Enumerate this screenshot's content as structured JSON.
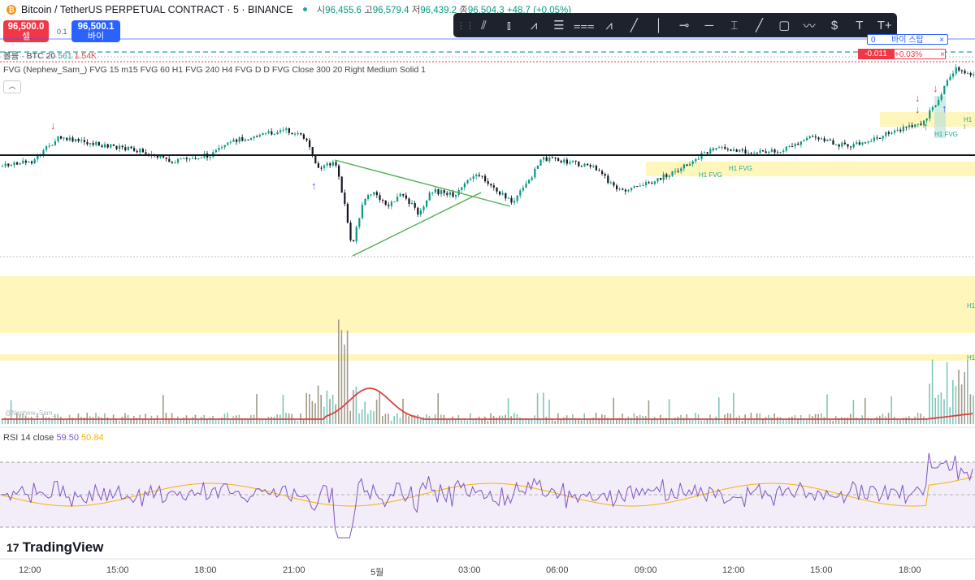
{
  "header": {
    "coin_symbol": "₿",
    "symbol_title": "Bitcoin / TetherUS PERPETUAL CONTRACT · 5 · BINANCE",
    "ohlc": {
      "o_label": "시",
      "o": "96,455.6",
      "h_label": "고",
      "h": "96,579.4",
      "l_label": "저",
      "l": "96,439.2",
      "c_label": "종",
      "c": "96,504.3",
      "change": "+48.7 (+0.05%)"
    }
  },
  "trade": {
    "sell_price": "96,500.0",
    "sell_label": "셀",
    "buy_price": "96,500.1",
    "buy_label": "바이",
    "spread": "0.1"
  },
  "toolbar": {
    "icons": [
      "grip-icon",
      "parallel-channel-icon",
      "regression-trend-icon",
      "xabcd-pattern-icon",
      "fib-retracement-icon",
      "fib-channel-icon",
      "abcd-pattern-icon",
      "trend-line-icon",
      "vertical-line-icon",
      "horizontal-ray-icon",
      "horizontal-line-icon",
      "text-anchor-icon",
      "ray-icon",
      "rectangle-icon",
      "path-icon",
      "price-label-icon",
      "text-icon",
      "text-plus-icon"
    ],
    "glyphs": [
      "⋮⋮",
      "⫽",
      "⫾",
      "⩘",
      "☰",
      "⩶",
      "⩘",
      "╱",
      "│",
      "⊸",
      "─",
      "⌶",
      "╱",
      "▢",
      "〰",
      "$",
      "T",
      "T+"
    ]
  },
  "indicators": {
    "volume": {
      "label": "볼륨 · BTC 20",
      "v1": "561",
      "v2": "1.54K"
    },
    "fvg": "FVG (Nephew_Sam_) FVG 15 m15 FVG 60 H1 FVG 240 H4 FVG D D FVG Close 300 20 Right Medium Solid 1",
    "rsi": {
      "label": "RSI 14 close",
      "value": "59.50",
      "ma": "50.84"
    }
  },
  "orders": {
    "stop_qty": "0",
    "stop_label": "바이 스탑",
    "close_x": "×",
    "pnl": "-0.011",
    "pnl_pct": "+0.03%"
  },
  "fvg_labels": {
    "a": "H1 FVG",
    "b": "H1 FVG",
    "c": "H1 FVG",
    "d": "H1 I",
    "e": "H1",
    "f": "H1"
  },
  "watermark": "@Nephew_Sam_",
  "branding": {
    "logo": "TradingView",
    "mark": "17"
  },
  "time_axis": {
    "labels": [
      "12:00",
      "15:00",
      "18:00",
      "21:00",
      "5월",
      "03:00",
      "06:00",
      "09:00",
      "12:00",
      "15:00",
      "18:00"
    ]
  },
  "colors": {
    "up": "#089981",
    "down": "#131722",
    "sell": "#f23645",
    "buy": "#2962ff",
    "fvg_fill": "#fff5b0",
    "rsi_line": "#7e57c2",
    "rsi_ma": "#f5b400",
    "vol_ma": "#e04040"
  }
}
